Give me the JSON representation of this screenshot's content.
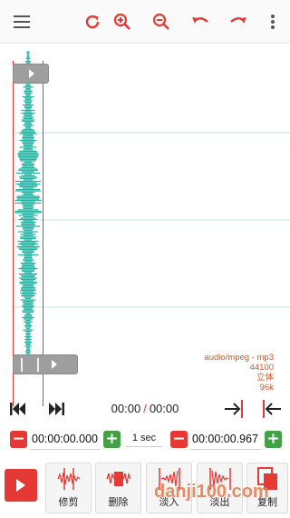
{
  "toolbar": {
    "icons": [
      "menu-icon",
      "refresh-icon",
      "zoom-in-icon",
      "zoom-out-icon",
      "undo-icon",
      "redo-icon",
      "more-vert-icon"
    ],
    "accent": "#e53935"
  },
  "waveform": {
    "color": "#26b5a5",
    "gridline_color": "#bfe3ea",
    "selection_color": "#e53935"
  },
  "meta": {
    "mime": "audio/mpeg - mp3",
    "sample_rate": "44100",
    "channels": "立体",
    "bitrate": "96k"
  },
  "transport": {
    "current": "00:00",
    "separator": "/",
    "total": "00:00"
  },
  "time_edit": {
    "start": "00:00:00.000",
    "step": "1 sec",
    "end": "00:00:00.967"
  },
  "actions": [
    {
      "label": "修剪"
    },
    {
      "label": "删除"
    },
    {
      "label": "淡入"
    },
    {
      "label": "淡出"
    },
    {
      "label": "复制"
    }
  ],
  "watermark": "danji100.com",
  "colors": {
    "red": "#e53935",
    "green": "#43a047",
    "meta_text": "#d65a2f"
  }
}
